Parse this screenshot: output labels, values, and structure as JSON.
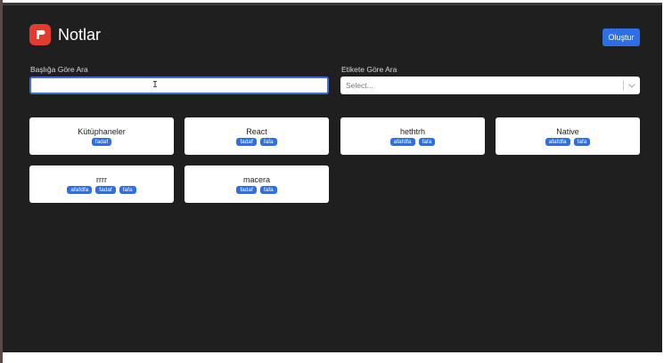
{
  "app": {
    "title": "Notlar"
  },
  "toolbar": {
    "create_label": "Oluştur"
  },
  "search": {
    "title_label": "Başlığa Göre Ara",
    "title_value": "",
    "tag_label": "Etikete Göre Ara",
    "tag_placeholder": "Select..."
  },
  "notes": [
    {
      "title": "Kütüphaneler",
      "tags": [
        "fadaf"
      ]
    },
    {
      "title": "React",
      "tags": [
        "fadaf",
        "fafa"
      ]
    },
    {
      "title": "hethtrh",
      "tags": [
        "afafdfa",
        "fafa"
      ]
    },
    {
      "title": "Native",
      "tags": [
        "afafdfa",
        "fafa"
      ]
    },
    {
      "title": "rrrr",
      "tags": [
        "afafdfa",
        "fadaf",
        "fafa"
      ]
    },
    {
      "title": "macera",
      "tags": [
        "fadaf",
        "fafa"
      ]
    }
  ],
  "colors": {
    "background": "#1f1f1f",
    "accent": "#2f6fe6",
    "logo": "#e23b32"
  }
}
